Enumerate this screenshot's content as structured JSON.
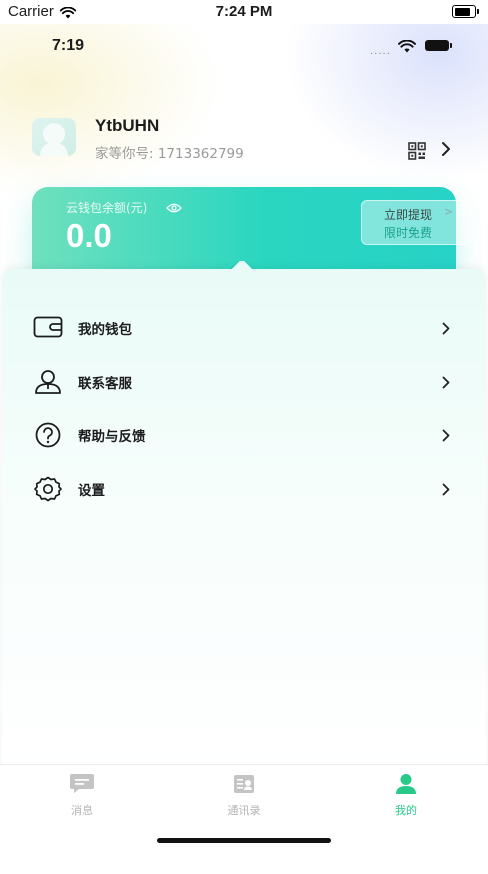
{
  "system_status": {
    "carrier": "Carrier",
    "time": "7:24 PM"
  },
  "app_status": {
    "time": "7:19",
    "dots": "....."
  },
  "profile": {
    "name": "YtbUHN",
    "id_label": "家等你号: 1713362799"
  },
  "wallet": {
    "label": "云钱包余额(元)",
    "amount": "0.0",
    "withdraw_label": "立即提现",
    "withdraw_sub": "限时免费",
    "withdraw_chevron": ">"
  },
  "menu": [
    {
      "label": "我的钱包",
      "icon": "wallet-icon"
    },
    {
      "label": "联系客服",
      "icon": "customer-service-icon"
    },
    {
      "label": "帮助与反馈",
      "icon": "help-icon"
    },
    {
      "label": "设置",
      "icon": "settings-icon"
    }
  ],
  "tabs": [
    {
      "label": "消息",
      "icon": "message-icon",
      "active": false
    },
    {
      "label": "通讯录",
      "icon": "contacts-icon",
      "active": false
    },
    {
      "label": "我的",
      "icon": "profile-icon",
      "active": true
    }
  ],
  "colors": {
    "accent": "#28c98a",
    "wallet_start": "#6fe0bd",
    "wallet_end": "#27d2c6",
    "inactive_tab": "#b4b4b4"
  }
}
